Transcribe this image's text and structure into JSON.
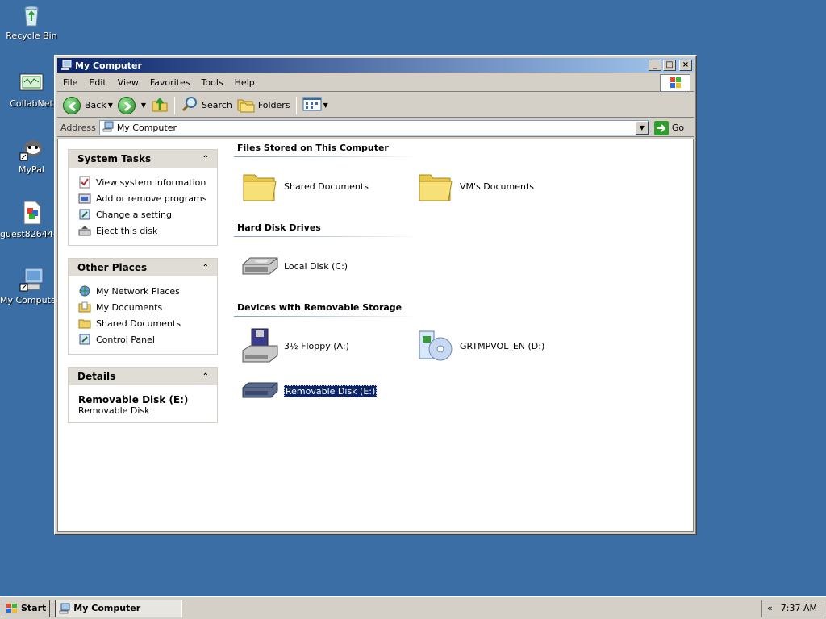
{
  "desktop": {
    "icons": [
      {
        "label": "Recycle Bin",
        "icon": "recycle-bin-icon"
      },
      {
        "label": "CollabNet",
        "icon": "collabnet-icon"
      },
      {
        "label": "MyPal",
        "icon": "mypal-icon"
      },
      {
        "label": "guest82644-...",
        "icon": "document-icon"
      },
      {
        "label": "My Compute...",
        "icon": "my-computer-icon"
      }
    ]
  },
  "window": {
    "title": "My Computer",
    "controls": {
      "minimize": "_",
      "maximize": "□",
      "close": "×"
    }
  },
  "menubar": {
    "items": [
      "File",
      "Edit",
      "View",
      "Favorites",
      "Tools",
      "Help"
    ]
  },
  "toolbar": {
    "back_label": "Back",
    "search_label": "Search",
    "folders_label": "Folders"
  },
  "address": {
    "label": "Address",
    "value": "My Computer",
    "go_label": "Go"
  },
  "left_pane": {
    "system_tasks": {
      "title": "System Tasks",
      "items": [
        "View system information",
        "Add or remove programs",
        "Change a setting",
        "Eject this disk"
      ]
    },
    "other_places": {
      "title": "Other Places",
      "items": [
        "My Network Places",
        "My Documents",
        "Shared Documents",
        "Control Panel"
      ]
    },
    "details": {
      "title": "Details",
      "name": "Removable Disk (E:)",
      "type": "Removable Disk"
    }
  },
  "groups": {
    "files_stored": {
      "title": "Files Stored on This Computer",
      "items": [
        "Shared Documents",
        "VM's Documents"
      ]
    },
    "hard_disks": {
      "title": "Hard Disk Drives",
      "items": [
        "Local Disk (C:)"
      ]
    },
    "removable": {
      "title": "Devices with Removable Storage",
      "items": [
        "3½ Floppy (A:)",
        "GRTMPVOL_EN (D:)",
        "Removable Disk (E:)"
      ]
    }
  },
  "taskbar": {
    "start_label": "Start",
    "task_label": "My Computer",
    "tray_arrow": "«",
    "clock": "7:37 AM"
  },
  "colors": {
    "desktop": "#3a6ea5",
    "titlebar_start": "#0a246a",
    "titlebar_end": "#a6caf0",
    "selection": "#0a246a"
  }
}
